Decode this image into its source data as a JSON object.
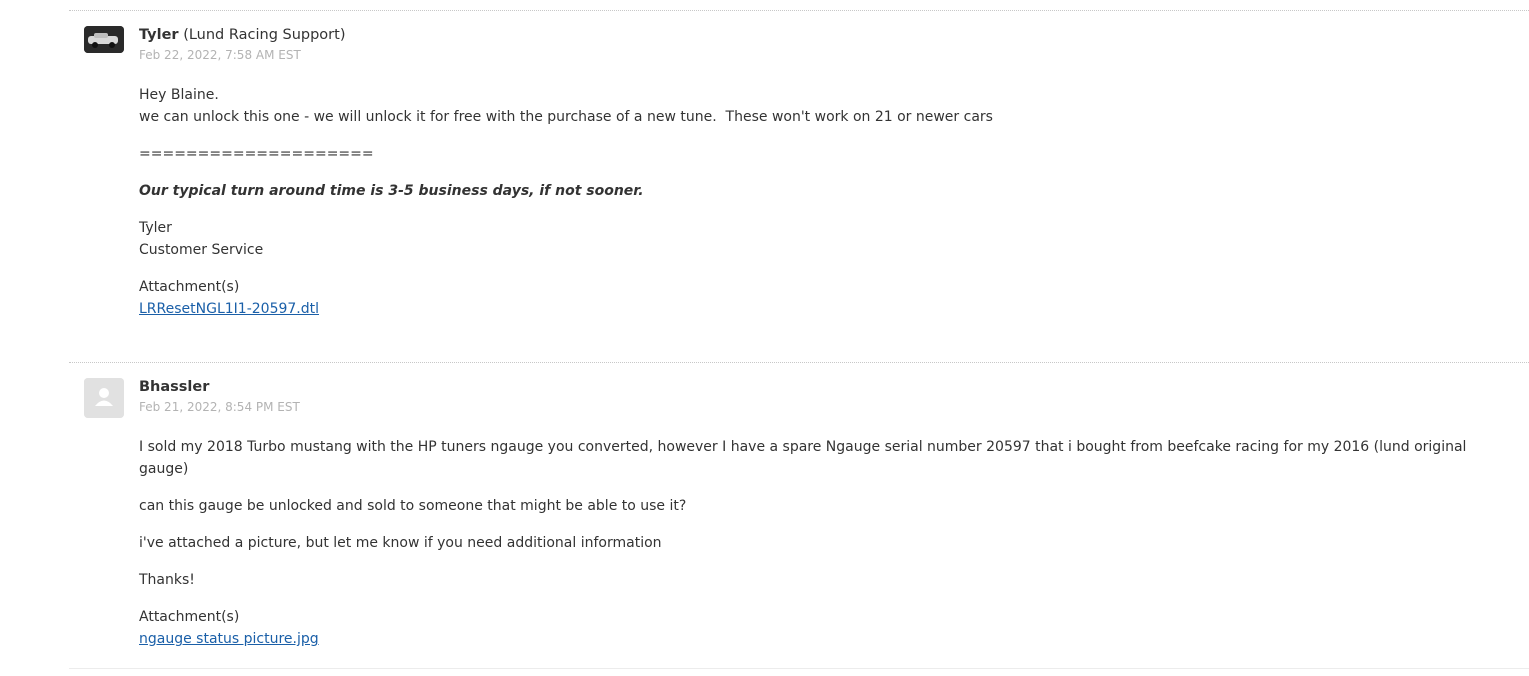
{
  "messages": [
    {
      "author_name": "Tyler",
      "author_role": "(Lund Racing Support)",
      "timestamp": "Feb 22, 2022, 7:58 AM EST",
      "lines": [
        "Hey Blaine.",
        "we can unlock this one - we will unlock it for free with the purchase of a new tune.  These won't work on 21 or newer cars"
      ],
      "separator": "====================",
      "italic_note": "Our typical turn around time is 3-5 business days, if not sooner.",
      "signature": [
        "Tyler",
        "Customer Service"
      ],
      "attachments_label": "Attachment(s)",
      "attachment": "LRResetNGL1I1-20597.dtl",
      "avatar_icon": "user-photo-icon"
    },
    {
      "author_name": "Bhassler",
      "timestamp": "Feb 21, 2022, 8:54 PM EST",
      "paragraphs": [
        "I sold my 2018 Turbo mustang with the HP tuners ngauge you converted, however I have a spare Ngauge serial number 20597 that i bought from beefcake racing for my 2016 (lund original gauge)",
        "can this gauge be unlocked and sold to someone that might be able to use it?",
        "i've attached a picture, but let me know if you need additional information",
        "Thanks!"
      ],
      "attachments_label": "Attachment(s)",
      "attachment": "ngauge status picture.jpg",
      "avatar_icon": "default-user-icon"
    }
  ],
  "colors": {
    "link": "#1a5fa8",
    "timestamp": "#b3b3b3",
    "text": "#333333"
  }
}
